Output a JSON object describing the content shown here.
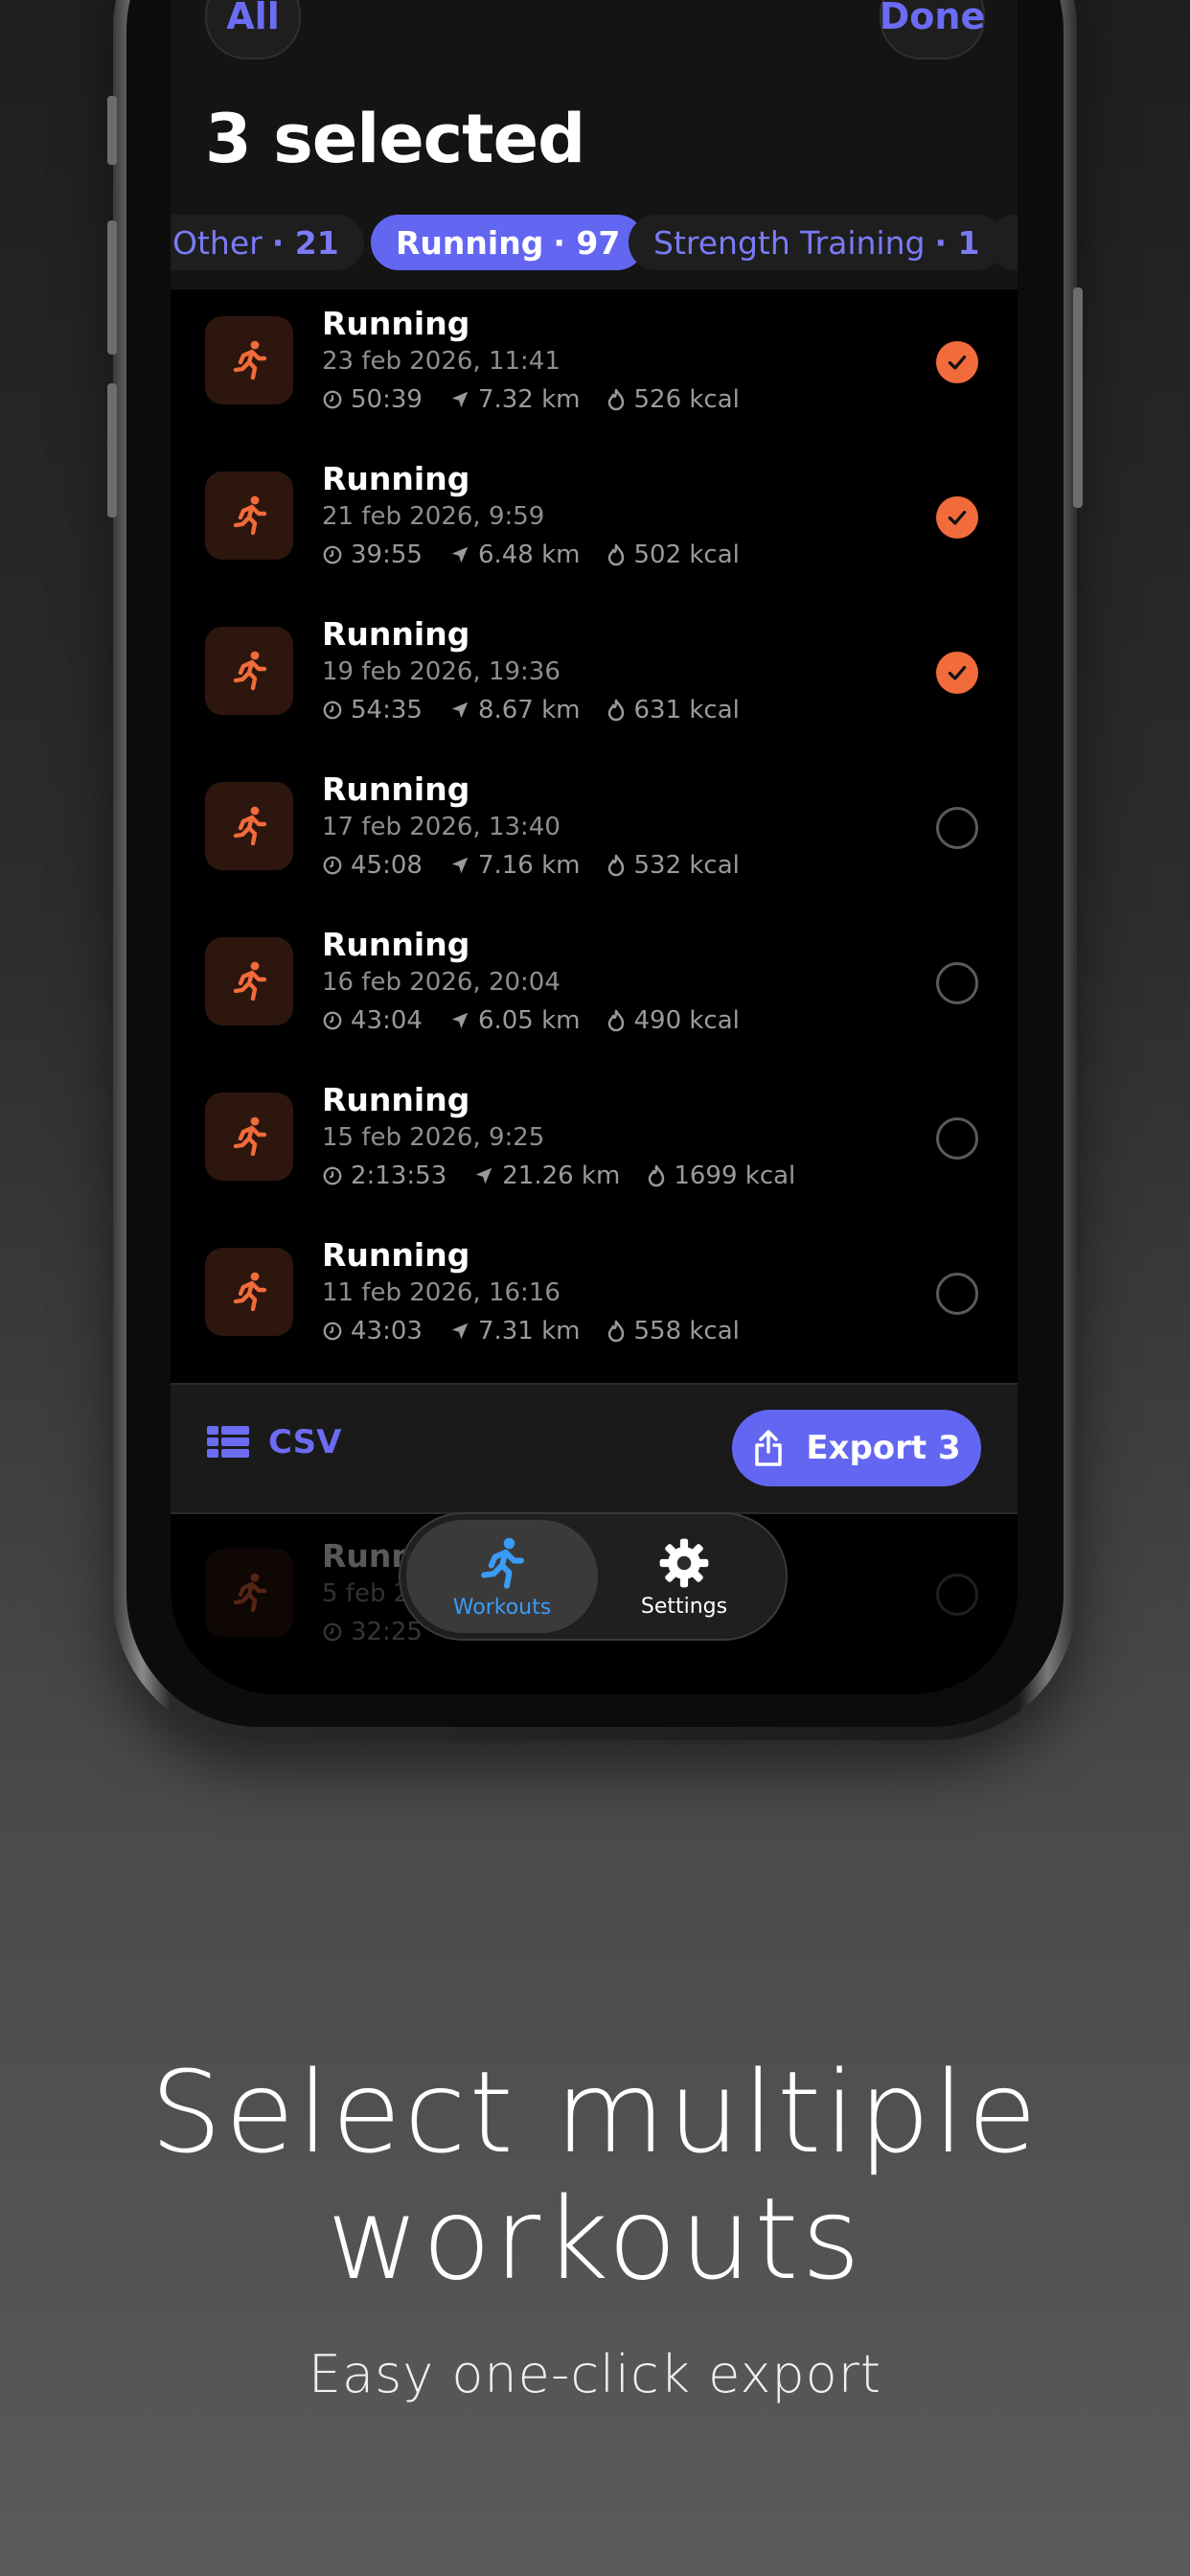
{
  "header": {
    "all_label": "All",
    "done_label": "Done",
    "title": "3 selected"
  },
  "filters": [
    {
      "label": "Other",
      "count": "· 21",
      "selected": false
    },
    {
      "label": "Running",
      "count": "· 97",
      "selected": true
    },
    {
      "label": "Strength Training",
      "count": "· 1",
      "selected": false
    }
  ],
  "workouts": [
    {
      "title": "Running",
      "date": "23 feb 2026, 11:41",
      "duration": "50:39",
      "distance": "7.32 km",
      "energy": "526 kcal",
      "selected": true
    },
    {
      "title": "Running",
      "date": "21 feb 2026, 9:59",
      "duration": "39:55",
      "distance": "6.48 km",
      "energy": "502 kcal",
      "selected": true
    },
    {
      "title": "Running",
      "date": "19 feb 2026, 19:36",
      "duration": "54:35",
      "distance": "8.67 km",
      "energy": "631 kcal",
      "selected": true
    },
    {
      "title": "Running",
      "date": "17 feb 2026, 13:40",
      "duration": "45:08",
      "distance": "7.16 km",
      "energy": "532 kcal",
      "selected": false
    },
    {
      "title": "Running",
      "date": "16 feb 2026, 20:04",
      "duration": "43:04",
      "distance": "6.05 km",
      "energy": "490 kcal",
      "selected": false
    },
    {
      "title": "Running",
      "date": "15 feb 2026, 9:25",
      "duration": "2:13:53",
      "distance": "21.26 km",
      "energy": "1699 kcal",
      "selected": false
    },
    {
      "title": "Running",
      "date": "11 feb 2026, 16:16",
      "duration": "43:03",
      "distance": "7.31 km",
      "energy": "558 kcal",
      "selected": false
    }
  ],
  "partial_row": {
    "title": "Runn",
    "date": "5 feb 2",
    "duration": "32:25"
  },
  "action_bar": {
    "format_label": "CSV",
    "export_label": "Export 3"
  },
  "tabbar": {
    "workouts_label": "Workouts",
    "settings_label": "Settings"
  },
  "marketing": {
    "headline_line1": "Select multiple",
    "headline_line2": "workouts",
    "subline": "Easy one-click export"
  },
  "colors": {
    "accent": "#6366f1",
    "check": "#f26b3a",
    "running_icon": "#f26b3a",
    "tab_active": "#3a9cf5"
  }
}
